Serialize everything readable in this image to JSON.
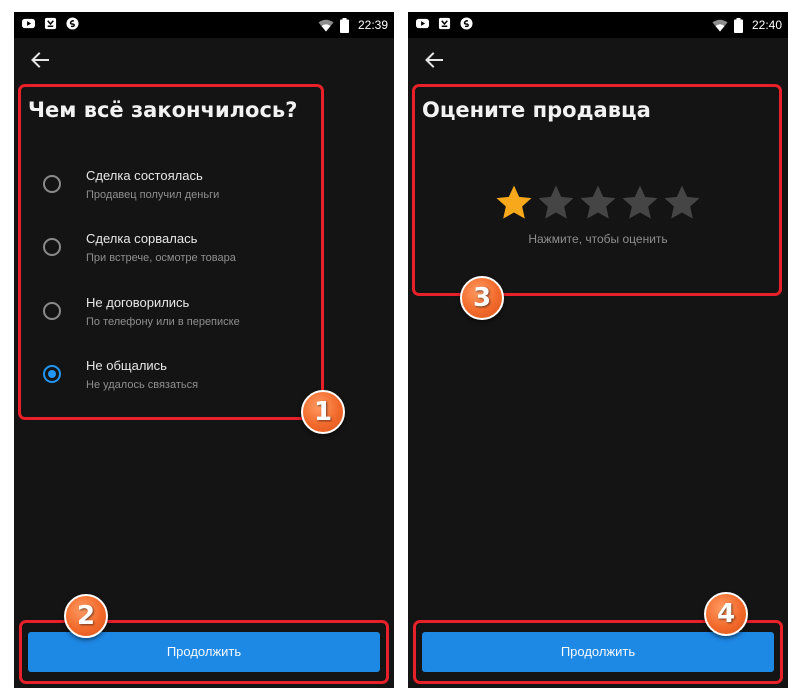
{
  "left_screen": {
    "status_bar": {
      "time": "22:39"
    },
    "title": "Чем всё закончилось?",
    "options": [
      {
        "title": "Сделка состоялась",
        "subtitle": "Продавец получил деньги",
        "selected": false
      },
      {
        "title": "Сделка сорвалась",
        "subtitle": "При встрече, осмотре товара",
        "selected": false
      },
      {
        "title": "Не договорились",
        "subtitle": "По телефону или в переписке",
        "selected": false
      },
      {
        "title": "Не общались",
        "subtitle": "Не удалось связаться",
        "selected": true
      }
    ],
    "continue_label": "Продолжить"
  },
  "right_screen": {
    "status_bar": {
      "time": "22:40"
    },
    "title": "Оцените продавца",
    "rating": {
      "value": 1,
      "max": 5
    },
    "rating_hint": "Нажмите, чтобы оценить",
    "continue_label": "Продолжить"
  },
  "annotations": {
    "badges": [
      "1",
      "2",
      "3",
      "4"
    ]
  },
  "colors": {
    "background": "#141414",
    "accent": "#1e88e5",
    "radio_checked": "#2196f3",
    "star_active": "#f7a81b",
    "star_inactive": "#454545",
    "annotation_red": "#e8202a",
    "badge_orange": "#f26a2b"
  },
  "icons": {
    "status_left": [
      "youtube-icon",
      "app-notification-icon",
      "shazam-icon"
    ],
    "status_right": [
      "wifi-icon",
      "battery-icon"
    ],
    "back": "arrow-left-icon",
    "star": "star-icon"
  }
}
